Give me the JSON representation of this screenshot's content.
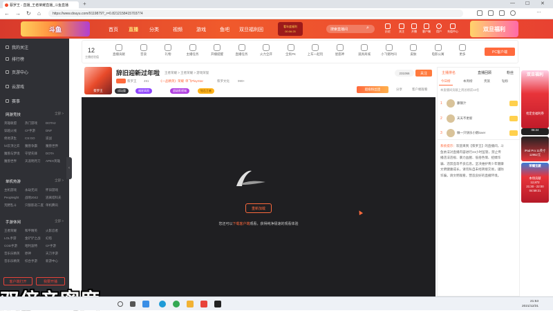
{
  "browser": {
    "tab_title": "蔡罗王 - 直播_王者荣耀直播_斗鱼直播",
    "url": "https://www.douyu.com/9119879?_r=0.8212158415703774",
    "new_tab": "+",
    "minimize": "—",
    "maximize": "☐",
    "close": "✕"
  },
  "header": {
    "logo_text": "斗鱼",
    "nav": [
      "首页",
      "直播",
      "分类",
      "视频",
      "游戏",
      "鱼吧",
      "双旦福利回"
    ],
    "active_nav": "直播",
    "ad_line1": "看年度福利",
    "ad_line2": "00:06:25",
    "search_placeholder": "搜索直播间",
    "icons": [
      {
        "name": "history-icon",
        "label": "历史"
      },
      {
        "name": "follow-icon",
        "label": "关注"
      },
      {
        "name": "broadcast-icon",
        "label": "开播"
      },
      {
        "name": "client-icon",
        "label": "客户端"
      },
      {
        "name": "user-icon",
        "label": "用户"
      },
      {
        "name": "wallet-icon",
        "label": "充值中心"
      }
    ],
    "banner_text": "双旦福利"
  },
  "sidebar": {
    "items": [
      "我的关注",
      "排行榜",
      "页游中心",
      "云游戏",
      "赛事"
    ],
    "sections": [
      {
        "title": "网游竞技",
        "more": "全部 >",
        "games": [
          "英雄联盟",
          "热门游戏",
          "DOTA2",
          "穿越火线",
          "CF手游",
          "DNF",
          "绝地求生",
          "CS:GO",
          "逆战",
          "lol云顶之弈",
          "魔兽争霸",
          "魔兽世界",
          "魔兽与梦境",
          "守望先锋",
          "DOTA",
          "魔兽世界",
          "天涯明月刀",
          "APEX英雄"
        ]
      },
      {
        "title": "单机热游",
        "more": "全部 >",
        "games": [
          "主机游戏",
          "永劫无间",
          "怀旧游戏",
          "Peopleight",
          "战地2042",
          "逃离塔科夫",
          "荒野乱斗",
          "只狼影逝二度",
          "单机腾讯"
        ]
      },
      {
        "title": "手游休闲",
        "more": "全部 >",
        "games": [
          "王者荣耀",
          "和平精英",
          "火影忍者",
          "LOL手游",
          "金铲铲之战",
          "幻塔",
          "COD手游",
          "哈利波特",
          "CF手游",
          "音乐乐精英",
          "原神",
          "天刀手游",
          "音乐乐精英",
          "综合手游",
          "新游中心"
        ]
      }
    ],
    "btn_client": "客户端打开",
    "btn_broadcast": "我要开播",
    "collapse": "‹"
  },
  "toprow": {
    "level_num": "12",
    "level_label": "主播经验值",
    "items": [
      "直播贡献",
      "音浪",
      "礼物",
      "主播任务",
      "开播提醒",
      "直播任务",
      "火力全开",
      "全民PK",
      "上车一起玩",
      "星座神",
      "道具商城",
      "小飞猪时间",
      "皮肤",
      "电影公寓",
      "更多"
    ],
    "pc_download": "PC客户端"
  },
  "streamer": {
    "avatar_text": "蔡罗王",
    "title": "辞旧迎新过年啦",
    "report": "举报",
    "category": "王者荣耀 > 王者荣耀 > 游戏荣誉",
    "name": "蔡罗王",
    "hot": "491",
    "activity": "《一品精英》荣耀",
    "activity2": "单飞PlayStar",
    "org": "蔡罗文化",
    "online": "999+",
    "fans": "231066",
    "follow": "关注",
    "share": "分享",
    "client_watch": "客户端观看",
    "tags": [
      "试玩版",
      "福星高照",
      "超级影视城",
      "钻石王者"
    ],
    "promo_btn": "超级粉丝团"
  },
  "player": {
    "retry": "重新加载",
    "hint_prefix": "您还可以",
    "hint_link": "下载客户端",
    "hint_suffix": "观看，获得纯净极速的观看体验"
  },
  "rightpanel": {
    "tabs": [
      "主播排名",
      "直播回顾",
      "粉丝"
    ],
    "subtabs": [
      "今日榜",
      "本周榜",
      "贵族",
      "钻粉"
    ],
    "note": "本直播间贡献上周总榜前10名",
    "ranks": [
      {
        "no": "1",
        "name": "藤钢汁"
      },
      {
        "no": "2",
        "name": "天天不更新"
      },
      {
        "no": "3",
        "name": "做一只快乐小鹅lover"
      }
    ],
    "sys_label": "系统提示：",
    "sys_msg": "欢迎来到【蔡罗王】的直播间，斗鱼依法对直播内容进行24小时监管，禁止传播违法违规、暴力血腥、低俗色情、招嫖诈骗、违禁品等不良信息。坚决维护青少年健康文明健康成长，请勿私自未经转接交易，谨防诈骗，请文明观看，营造良好的直播环境。"
  },
  "promo": {
    "card1": "双旦福利",
    "card2_title": "抢定金福利券",
    "card2_time": "06:24",
    "card3_title": "iPad Pro 11英寸",
    "card3_value": "12952元",
    "card4_title": "荣耀宝藏",
    "card4_sub": "本场贡献",
    "card4_val": "12,872",
    "card4_time1": "21:30 - 22:00",
    "card4_time2": "04:59:21"
  },
  "caption": "双倍亲密度",
  "taskbar": {
    "time": "21:53",
    "date": "2021/12/31"
  }
}
